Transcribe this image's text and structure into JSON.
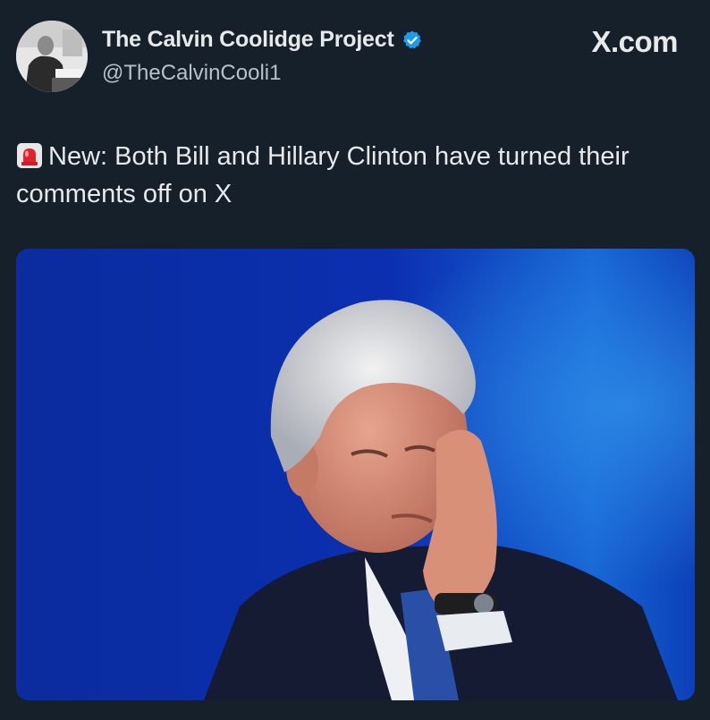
{
  "author": {
    "display_name": "The Calvin Coolidge Project",
    "handle": "@TheCalvinCooli1",
    "verified": true,
    "avatar_icon": "portrait-avatar"
  },
  "brand": {
    "label": "X.com",
    "icon": "x-logo-icon"
  },
  "tweet": {
    "emoji_icon": "siren-icon",
    "text": "New: Both Bill and Hillary Clinton have turned their comments off on X"
  },
  "media": {
    "type": "photo",
    "icon": "photo-man-on-blue-background"
  },
  "colors": {
    "background": "#15202b",
    "text": "#e7e9ea",
    "secondary_text": "#b8c0c8",
    "verified": "#1d9bf0",
    "photo_background": "#0a2a9a"
  }
}
